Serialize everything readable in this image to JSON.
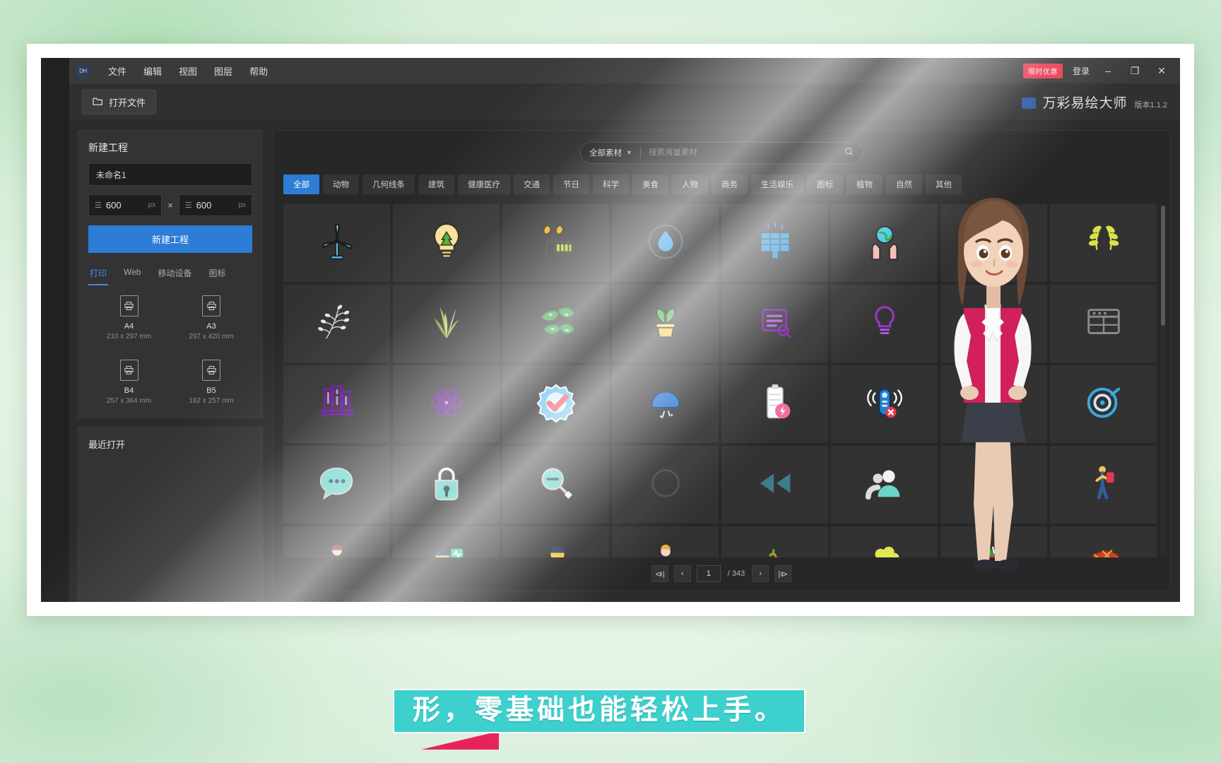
{
  "titlebar": {
    "app_badge": "DH",
    "menus": [
      "文件",
      "编辑",
      "视图",
      "图层",
      "帮助"
    ],
    "promo_badge": "限时优惠",
    "login": "登录",
    "minimize": "–",
    "maximize": "❐",
    "close": "✕"
  },
  "toolbar": {
    "open_file": "打开文件",
    "brand_name": "万彩易绘大师",
    "brand_version": "版本1.1.2"
  },
  "left_panel": {
    "new_project_title": "新建工程",
    "project_name_value": "未命名1",
    "project_name_placeholder": "未命名1",
    "width_value": "600",
    "width_unit": "px",
    "height_value": "600",
    "height_unit": "px",
    "multiply_symbol": "×",
    "create_button": "新建工程",
    "device_tabs": [
      "打印",
      "Web",
      "移动设备",
      "图标"
    ],
    "active_device_tab": "打印",
    "presets": [
      {
        "name": "A4",
        "dim": "210 x 297 mm"
      },
      {
        "name": "A3",
        "dim": "297 x 420 mm"
      },
      {
        "name": "B4",
        "dim": "257 x 364 mm"
      },
      {
        "name": "B5",
        "dim": "182 x 257 mm"
      }
    ],
    "recent_title": "最近打开"
  },
  "search": {
    "scope": "全部素材",
    "placeholder": "搜索海量素材"
  },
  "categories": [
    "全部",
    "动物",
    "几何线条",
    "建筑",
    "健康医疗",
    "交通",
    "节日",
    "科学",
    "美食",
    "人物",
    "商务",
    "生活娱乐",
    "图标",
    "植物",
    "自然",
    "其他"
  ],
  "active_category": "全部",
  "assets": [
    {
      "name": "wind-turbine-icon",
      "glyph": ""
    },
    {
      "name": "eco-lightbulb-icon",
      "glyph": ""
    },
    {
      "name": "eco-battery-icon",
      "glyph": ""
    },
    {
      "name": "water-drop-icon",
      "glyph": ""
    },
    {
      "name": "solar-panel-icon",
      "glyph": ""
    },
    {
      "name": "hands-earth-icon",
      "glyph": ""
    },
    {
      "name": "wheat-icon",
      "glyph": ""
    },
    {
      "name": "laurel-branch-icon",
      "glyph": ""
    },
    {
      "name": "dry-branch-icon",
      "glyph": ""
    },
    {
      "name": "grass-tuft-icon",
      "glyph": ""
    },
    {
      "name": "leaves-icon",
      "glyph": ""
    },
    {
      "name": "potted-plant-icon",
      "glyph": ""
    },
    {
      "name": "document-lines-icon",
      "glyph": ""
    },
    {
      "name": "idea-bulb-icon",
      "glyph": ""
    },
    {
      "name": "brain-idea-icon",
      "glyph": ""
    },
    {
      "name": "window-frame-icon",
      "glyph": ""
    },
    {
      "name": "bookshelf-icon",
      "glyph": ""
    },
    {
      "name": "atom-icon",
      "glyph": ""
    },
    {
      "name": "verified-check-icon",
      "glyph": ""
    },
    {
      "name": "bike-helmet-icon",
      "glyph": ""
    },
    {
      "name": "charging-battery-icon",
      "glyph": ""
    },
    {
      "name": "remote-control-icon",
      "glyph": ""
    },
    {
      "name": "basketball-icon",
      "glyph": ""
    },
    {
      "name": "target-clock-icon",
      "glyph": ""
    },
    {
      "name": "chat-bubble-icon",
      "glyph": ""
    },
    {
      "name": "padlock-icon",
      "glyph": ""
    },
    {
      "name": "zoom-out-icon",
      "glyph": ""
    },
    {
      "name": "dim-circle-icon",
      "glyph": ""
    },
    {
      "name": "rewind-icon",
      "glyph": ""
    },
    {
      "name": "user-group-icon",
      "glyph": ""
    },
    {
      "name": "skateboarder-icon",
      "glyph": ""
    },
    {
      "name": "hiker-icon",
      "glyph": ""
    },
    {
      "name": "businessman-icon",
      "glyph": ""
    },
    {
      "name": "doctor-icon",
      "glyph": ""
    },
    {
      "name": "patient-scan-icon",
      "glyph": ""
    },
    {
      "name": "worker-overalls-icon",
      "glyph": ""
    },
    {
      "name": "chili-pepper-icon",
      "glyph": ""
    },
    {
      "name": "broccoli-icon",
      "glyph": ""
    },
    {
      "name": "strawberry-icon",
      "glyph": ""
    },
    {
      "name": "steak-icon",
      "glyph": ""
    }
  ],
  "pager": {
    "first": "⧏|",
    "prev": "‹",
    "current_page": "1",
    "total_pages": "/ 343",
    "next": "›",
    "last": "|⧐"
  },
  "caption": {
    "text": "形，零基础也能轻松上手。"
  },
  "colors": {
    "accent_blue": "#2d7cd6",
    "caption_teal": "#3ed0cd",
    "caption_tail_pink": "#e8235c",
    "promo_red": "#e8384f",
    "panel_bg": "#333333",
    "window_bg": "#2b2b2b"
  }
}
